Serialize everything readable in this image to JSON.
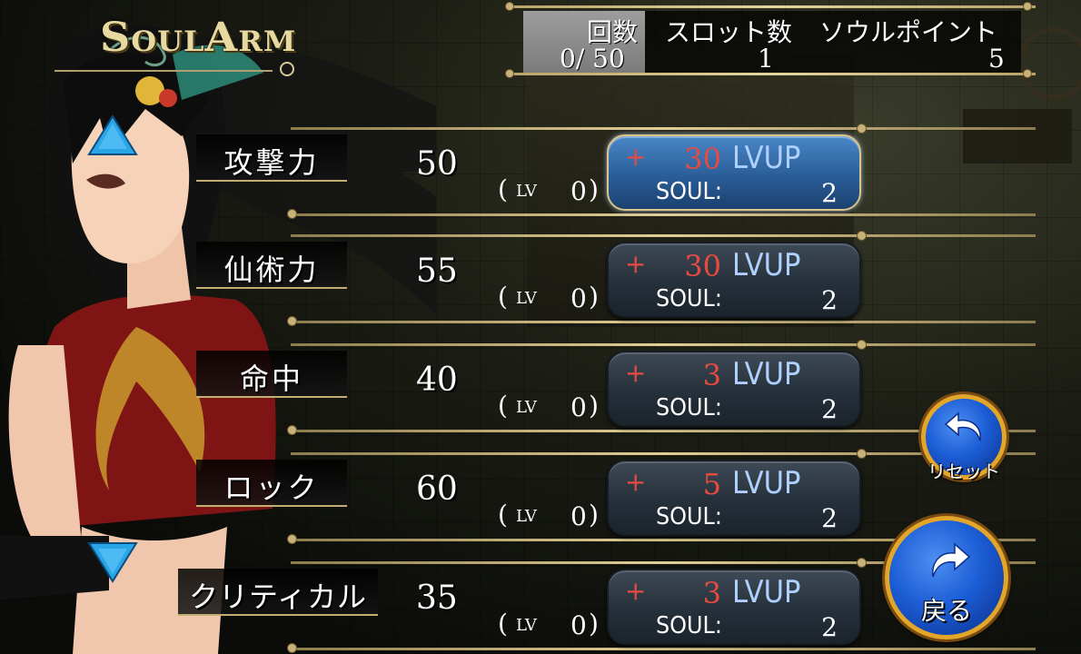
{
  "logo": {
    "text_main": "S",
    "text_rest1": "OUL",
    "text_A": "A",
    "text_rest2": "RM"
  },
  "header": {
    "count_label": "回数",
    "count_value": "0/ 50",
    "slots_label": "スロット数",
    "slots_value": "1",
    "soulpoint_label": "ソウルポイント",
    "soulpoint_value": "5"
  },
  "stats": [
    {
      "name": "攻撃力",
      "value": "50",
      "lv": "0",
      "plus": "+",
      "amount": "30",
      "lvup": "LVUP",
      "soul_label": "SOUL:",
      "cost": "2"
    },
    {
      "name": "仙術力",
      "value": "55",
      "lv": "0",
      "plus": "+",
      "amount": "30",
      "lvup": "LVUP",
      "soul_label": "SOUL:",
      "cost": "2"
    },
    {
      "name": "命中",
      "value": "40",
      "lv": "0",
      "plus": "+",
      "amount": "3",
      "lvup": "LVUP",
      "soul_label": "SOUL:",
      "cost": "2"
    },
    {
      "name": "ロック",
      "value": "60",
      "lv": "0",
      "plus": "+",
      "amount": "5",
      "lvup": "LVUP",
      "soul_label": "SOUL:",
      "cost": "2"
    },
    {
      "name": "クリティカル",
      "value": "35",
      "lv": "0",
      "plus": "+",
      "amount": "3",
      "lvup": "LVUP",
      "soul_label": "SOUL:",
      "cost": "2"
    }
  ],
  "lv_label": "LV",
  "paren_open": "(",
  "paren_close": ")",
  "buttons": {
    "reset": "リセット",
    "back": "戻る"
  },
  "colors": {
    "accent_gold": "#e2a62a",
    "button_blue": "#1c5ed6",
    "amount_red": "#e84a3f",
    "lvup_blue": "#aed0ff"
  }
}
